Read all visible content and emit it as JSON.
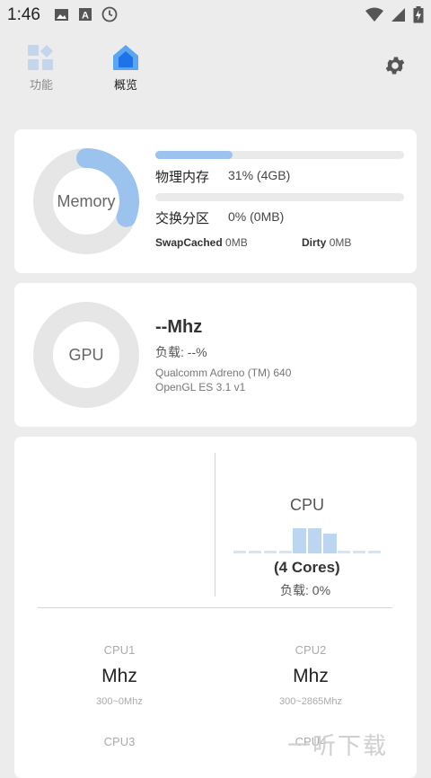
{
  "status_bar": {
    "time": "1:46"
  },
  "tabs": [
    {
      "label": "功能"
    },
    {
      "label": "概览"
    }
  ],
  "memory": {
    "ring_label": "Memory",
    "ring_fraction": 0.31,
    "physical_label": "物理内存",
    "physical_value": "31% (4GB)",
    "physical_fraction": 0.31,
    "swap_label": "交换分区",
    "swap_value": "0% (0MB)",
    "swap_fraction": 0.0,
    "swapcached_label": "SwapCached",
    "swapcached_value": "0MB",
    "dirty_label": "Dirty",
    "dirty_value": "0MB"
  },
  "gpu": {
    "ring_label": "GPU",
    "freq": "--Mhz",
    "load": "负载: --%",
    "renderer": "Qualcomm Adreno (TM) 640",
    "gl_version": "OpenGL ES 3.1 v1"
  },
  "cpu": {
    "title": "CPU",
    "cores": "(4 Cores)",
    "load": "负载: 0%",
    "core_list": [
      {
        "name": "CPU1",
        "freq": "Mhz",
        "range": "300~0Mhz"
      },
      {
        "name": "CPU2",
        "freq": "Mhz",
        "range": "300~2865Mhz"
      },
      {
        "name": "CPU3"
      },
      {
        "name": "CPU4"
      }
    ]
  },
  "watermark": "一听下载",
  "colors": {
    "accent": "#9cc3ee",
    "ring_bg": "#e6e6e6",
    "tab_active": "#1e73e8"
  }
}
